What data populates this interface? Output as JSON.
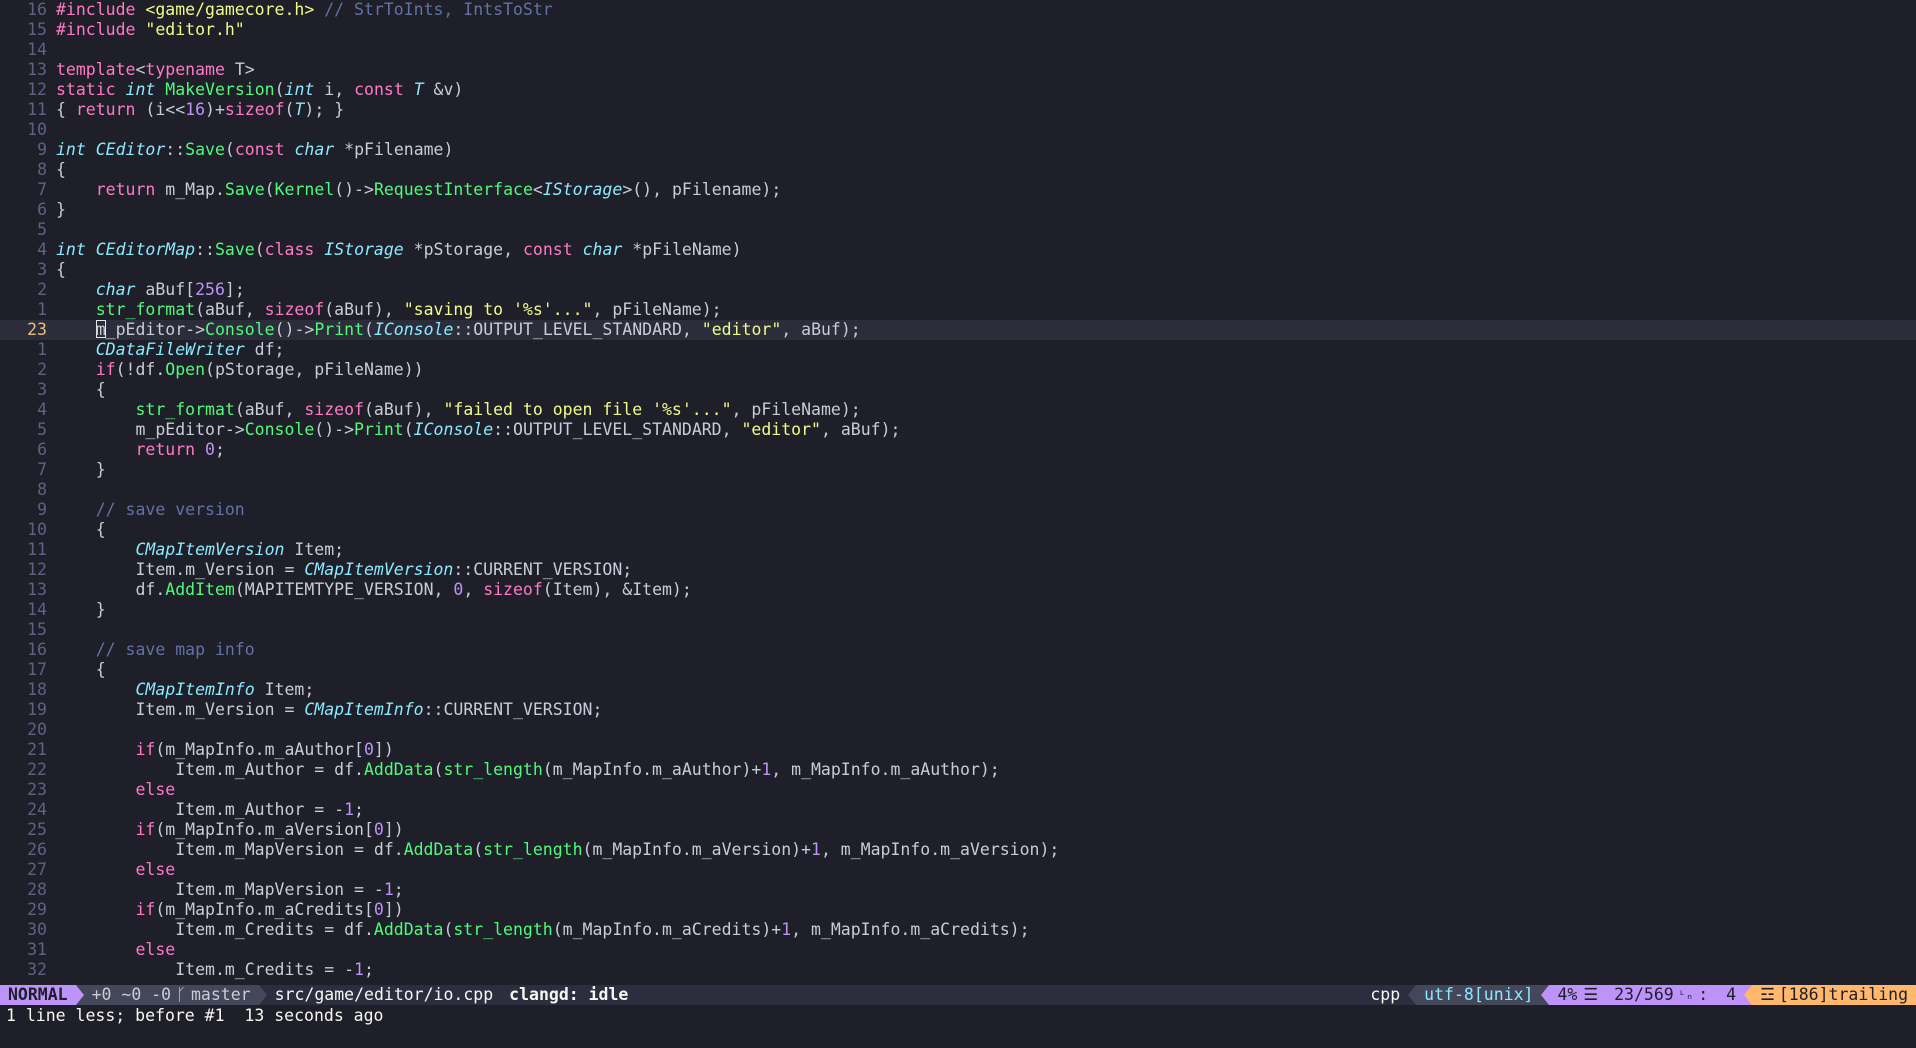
{
  "editor": {
    "lines": [
      {
        "n": "16",
        "t": [
          [
            "pp",
            "#include "
          ],
          [
            "inc",
            "<game/gamecore.h>"
          ],
          [
            "cm",
            " // StrToInts, IntsToStr"
          ]
        ]
      },
      {
        "n": "15",
        "t": [
          [
            "pp",
            "#include "
          ],
          [
            "inc",
            "\"editor.h\""
          ]
        ]
      },
      {
        "n": "14",
        "t": []
      },
      {
        "n": "13",
        "t": [
          [
            "kw",
            "template"
          ],
          [
            "id",
            "<"
          ],
          [
            "kw",
            "typename"
          ],
          [
            "id",
            " T>"
          ]
        ]
      },
      {
        "n": "12",
        "t": [
          [
            "kw",
            "static "
          ],
          [
            "ty",
            "int "
          ],
          [
            "fn",
            "MakeVersion"
          ],
          [
            "id",
            "("
          ],
          [
            "ty",
            "int"
          ],
          [
            "id",
            " i, "
          ],
          [
            "kw",
            "const "
          ],
          [
            "ty",
            "T"
          ],
          [
            "id",
            " &v)"
          ]
        ]
      },
      {
        "n": "11",
        "t": [
          [
            "id",
            "{ "
          ],
          [
            "kw",
            "return"
          ],
          [
            "id",
            " (i<<"
          ],
          [
            "nu",
            "16"
          ],
          [
            "id",
            ")+"
          ],
          [
            "kw",
            "sizeof"
          ],
          [
            "id",
            "("
          ],
          [
            "ty",
            "T"
          ],
          [
            "id",
            "); }"
          ]
        ]
      },
      {
        "n": "10",
        "t": []
      },
      {
        "n": "9",
        "t": [
          [
            "ty",
            "int "
          ],
          [
            "ty",
            "CEditor"
          ],
          [
            "id",
            "::"
          ],
          [
            "fn",
            "Save"
          ],
          [
            "id",
            "("
          ],
          [
            "kw",
            "const "
          ],
          [
            "ty",
            "char"
          ],
          [
            "id",
            " *pFilename)"
          ]
        ]
      },
      {
        "n": "8",
        "t": [
          [
            "id",
            "{"
          ]
        ]
      },
      {
        "n": "7",
        "t": [
          [
            "kw",
            "    return"
          ],
          [
            "id",
            " m_Map."
          ],
          [
            "fn",
            "Save"
          ],
          [
            "id",
            "("
          ],
          [
            "fn",
            "Kernel"
          ],
          [
            "id",
            "()->"
          ],
          [
            "fn",
            "RequestInterface"
          ],
          [
            "id",
            "<"
          ],
          [
            "ty",
            "IStorage"
          ],
          [
            "id",
            ">(), pFilename);"
          ]
        ]
      },
      {
        "n": "6",
        "t": [
          [
            "id",
            "}"
          ]
        ]
      },
      {
        "n": "5",
        "t": []
      },
      {
        "n": "4",
        "t": [
          [
            "ty",
            "int "
          ],
          [
            "ty",
            "CEditorMap"
          ],
          [
            "id",
            "::"
          ],
          [
            "fn",
            "Save"
          ],
          [
            "id",
            "("
          ],
          [
            "kw",
            "class "
          ],
          [
            "ty",
            "IStorage"
          ],
          [
            "id",
            " *pStorage, "
          ],
          [
            "kw",
            "const "
          ],
          [
            "ty",
            "char"
          ],
          [
            "id",
            " *pFileName)"
          ]
        ]
      },
      {
        "n": "3",
        "t": [
          [
            "id",
            "{"
          ]
        ]
      },
      {
        "n": "2",
        "t": [
          [
            "ty",
            "    char"
          ],
          [
            "id",
            " aBuf["
          ],
          [
            "nu",
            "256"
          ],
          [
            "id",
            "];"
          ]
        ]
      },
      {
        "n": "1",
        "t": [
          [
            "fn",
            "    str_format"
          ],
          [
            "id",
            "(aBuf, "
          ],
          [
            "kw",
            "sizeof"
          ],
          [
            "id",
            "(aBuf), "
          ],
          [
            "st",
            "\"saving to '%s'...\""
          ],
          [
            "id",
            ", pFileName);"
          ]
        ]
      },
      {
        "n": "23",
        "cur": true,
        "t": [
          [
            "id",
            "    "
          ],
          [
            "cursor",
            ""
          ],
          [
            "id",
            "m_pEditor->"
          ],
          [
            "fn",
            "Console"
          ],
          [
            "id",
            "()->"
          ],
          [
            "fn",
            "Print"
          ],
          [
            "id",
            "("
          ],
          [
            "ty",
            "IConsole"
          ],
          [
            "id",
            "::OUTPUT_LEVEL_STANDARD, "
          ],
          [
            "st",
            "\"editor\""
          ],
          [
            "id",
            ", aBuf);"
          ]
        ]
      },
      {
        "n": "1",
        "t": [
          [
            "ty",
            "    CDataFileWriter"
          ],
          [
            "id",
            " df;"
          ]
        ]
      },
      {
        "n": "2",
        "t": [
          [
            "kw",
            "    if"
          ],
          [
            "id",
            "(!df."
          ],
          [
            "fn",
            "Open"
          ],
          [
            "id",
            "(pStorage, pFileName))"
          ]
        ]
      },
      {
        "n": "3",
        "t": [
          [
            "id",
            "    {"
          ]
        ]
      },
      {
        "n": "4",
        "t": [
          [
            "fn",
            "        str_format"
          ],
          [
            "id",
            "(aBuf, "
          ],
          [
            "kw",
            "sizeof"
          ],
          [
            "id",
            "(aBuf), "
          ],
          [
            "st",
            "\"failed to open file '%s'...\""
          ],
          [
            "id",
            ", pFileName);"
          ]
        ]
      },
      {
        "n": "5",
        "t": [
          [
            "id",
            "        m_pEditor->"
          ],
          [
            "fn",
            "Console"
          ],
          [
            "id",
            "()->"
          ],
          [
            "fn",
            "Print"
          ],
          [
            "id",
            "("
          ],
          [
            "ty",
            "IConsole"
          ],
          [
            "id",
            "::OUTPUT_LEVEL_STANDARD, "
          ],
          [
            "st",
            "\"editor\""
          ],
          [
            "id",
            ", aBuf);"
          ]
        ]
      },
      {
        "n": "6",
        "t": [
          [
            "kw",
            "        return "
          ],
          [
            "nu",
            "0"
          ],
          [
            "id",
            ";"
          ]
        ]
      },
      {
        "n": "7",
        "t": [
          [
            "id",
            "    }"
          ]
        ]
      },
      {
        "n": "8",
        "t": []
      },
      {
        "n": "9",
        "t": [
          [
            "cm",
            "    // save version"
          ]
        ]
      },
      {
        "n": "10",
        "t": [
          [
            "id",
            "    {"
          ]
        ]
      },
      {
        "n": "11",
        "t": [
          [
            "ty",
            "        CMapItemVersion"
          ],
          [
            "id",
            " Item;"
          ]
        ]
      },
      {
        "n": "12",
        "t": [
          [
            "id",
            "        Item.m_Version = "
          ],
          [
            "ty",
            "CMapItemVersion"
          ],
          [
            "id",
            "::CURRENT_VERSION;"
          ]
        ]
      },
      {
        "n": "13",
        "t": [
          [
            "id",
            "        df."
          ],
          [
            "fn",
            "AddItem"
          ],
          [
            "id",
            "(MAPITEMTYPE_VERSION, "
          ],
          [
            "nu",
            "0"
          ],
          [
            "id",
            ", "
          ],
          [
            "kw",
            "sizeof"
          ],
          [
            "id",
            "(Item), &Item);"
          ]
        ]
      },
      {
        "n": "14",
        "t": [
          [
            "id",
            "    }"
          ]
        ]
      },
      {
        "n": "15",
        "t": []
      },
      {
        "n": "16",
        "t": [
          [
            "cm",
            "    // save map info"
          ]
        ]
      },
      {
        "n": "17",
        "t": [
          [
            "id",
            "    {"
          ]
        ]
      },
      {
        "n": "18",
        "t": [
          [
            "ty",
            "        CMapItemInfo"
          ],
          [
            "id",
            " Item;"
          ]
        ]
      },
      {
        "n": "19",
        "t": [
          [
            "id",
            "        Item.m_Version = "
          ],
          [
            "ty",
            "CMapItemInfo"
          ],
          [
            "id",
            "::CURRENT_VERSION;"
          ]
        ]
      },
      {
        "n": "20",
        "t": []
      },
      {
        "n": "21",
        "t": [
          [
            "kw",
            "        if"
          ],
          [
            "id",
            "(m_MapInfo.m_aAuthor["
          ],
          [
            "nu",
            "0"
          ],
          [
            "id",
            "])"
          ]
        ]
      },
      {
        "n": "22",
        "t": [
          [
            "id",
            "            Item.m_Author = df."
          ],
          [
            "fn",
            "AddData"
          ],
          [
            "id",
            "("
          ],
          [
            "fn",
            "str_length"
          ],
          [
            "id",
            "(m_MapInfo.m_aAuthor)+"
          ],
          [
            "nu",
            "1"
          ],
          [
            "id",
            ", m_MapInfo.m_aAuthor);"
          ]
        ]
      },
      {
        "n": "23",
        "t": [
          [
            "kw",
            "        else"
          ]
        ]
      },
      {
        "n": "24",
        "t": [
          [
            "id",
            "            Item.m_Author = -"
          ],
          [
            "nu",
            "1"
          ],
          [
            "id",
            ";"
          ]
        ]
      },
      {
        "n": "25",
        "t": [
          [
            "kw",
            "        if"
          ],
          [
            "id",
            "(m_MapInfo.m_aVersion["
          ],
          [
            "nu",
            "0"
          ],
          [
            "id",
            "])"
          ]
        ]
      },
      {
        "n": "26",
        "t": [
          [
            "id",
            "            Item.m_MapVersion = df."
          ],
          [
            "fn",
            "AddData"
          ],
          [
            "id",
            "("
          ],
          [
            "fn",
            "str_length"
          ],
          [
            "id",
            "(m_MapInfo.m_aVersion)+"
          ],
          [
            "nu",
            "1"
          ],
          [
            "id",
            ", m_MapInfo.m_aVersion);"
          ]
        ]
      },
      {
        "n": "27",
        "t": [
          [
            "kw",
            "        else"
          ]
        ]
      },
      {
        "n": "28",
        "t": [
          [
            "id",
            "            Item.m_MapVersion = -"
          ],
          [
            "nu",
            "1"
          ],
          [
            "id",
            ";"
          ]
        ]
      },
      {
        "n": "29",
        "t": [
          [
            "kw",
            "        if"
          ],
          [
            "id",
            "(m_MapInfo.m_aCredits["
          ],
          [
            "nu",
            "0"
          ],
          [
            "id",
            "])"
          ]
        ]
      },
      {
        "n": "30",
        "t": [
          [
            "id",
            "            Item.m_Credits = df."
          ],
          [
            "fn",
            "AddData"
          ],
          [
            "id",
            "("
          ],
          [
            "fn",
            "str_length"
          ],
          [
            "id",
            "(m_MapInfo.m_aCredits)+"
          ],
          [
            "nu",
            "1"
          ],
          [
            "id",
            ", m_MapInfo.m_aCredits);"
          ]
        ]
      },
      {
        "n": "31",
        "t": [
          [
            "kw",
            "        else"
          ]
        ]
      },
      {
        "n": "32",
        "t": [
          [
            "id",
            "            Item.m_Credits = -"
          ],
          [
            "nu",
            "1"
          ],
          [
            "id",
            ";"
          ]
        ]
      }
    ]
  },
  "status": {
    "mode": "NORMAL",
    "diff": "+0 ~0 -0",
    "branch_icon": "ᚴ",
    "branch": "master",
    "file": "src/game/editor/io.cpp",
    "lsp": "clangd: idle",
    "filetype": "cpp",
    "encoding": "utf-8[unix]",
    "percent": "4%",
    "percent_icon": "☰",
    "position": "23/569",
    "position_icon": "ᴸₙ",
    "column_sep": ":",
    "column": "4",
    "warn_icon": "☲",
    "warning": "[186]trailing"
  },
  "cmdline": "1 line less; before #1  13 seconds ago",
  "colors": {
    "background": "#1e1f29",
    "mode_bg": "#bd93f9",
    "warning_bg": "#ffb86c"
  }
}
